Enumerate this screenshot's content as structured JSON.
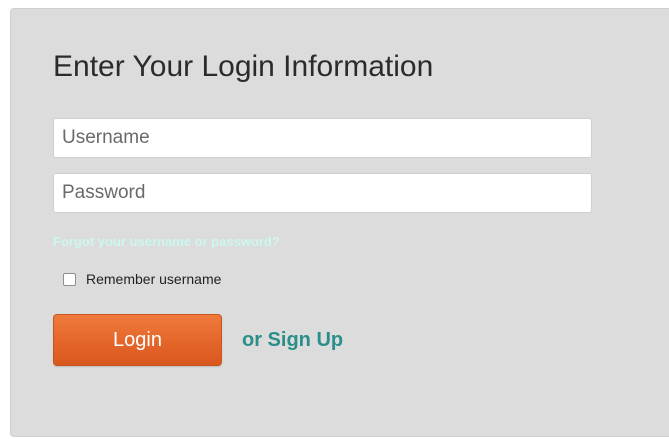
{
  "form": {
    "title": "Enter Your Login Information",
    "username_placeholder": "Username",
    "password_placeholder": "Password",
    "forgot_link": "Forgot your username or password?",
    "remember_label": "Remember username",
    "remember_checked": false,
    "login_button": "Login",
    "signup_link": "or Sign Up"
  },
  "colors": {
    "panel_background": "#dcdcdc",
    "login_button": "#e4652a",
    "signup_link": "#2a8f8a",
    "forgot_link": "#ccf6f0"
  }
}
